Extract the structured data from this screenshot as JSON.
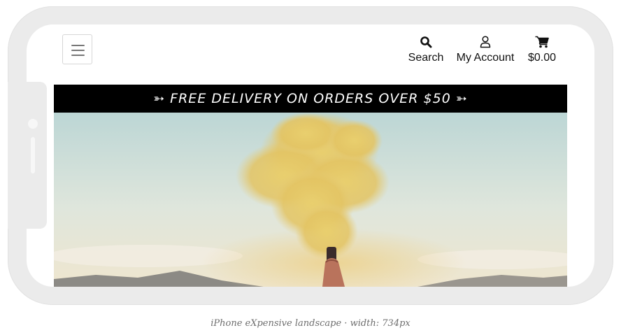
{
  "header": {
    "search_label": "Search",
    "account_label": "My Account",
    "cart_total": "$0.00",
    "icons": {
      "menu": "hamburger-menu-icon",
      "search": "search-icon",
      "account": "user-icon",
      "cart": "cart-icon"
    }
  },
  "promo": {
    "text": "➳ FREE DELIVERY ON ORDERS OVER $50 ➳"
  },
  "caption": {
    "text": "iPhone eXpensive landscape · width: 734px"
  },
  "colors": {
    "frame": "#ebebeb",
    "promo_background": "#000000",
    "promo_text": "#ffffff",
    "sky": "#cfe0dc",
    "smoke": "#e6c86a"
  }
}
